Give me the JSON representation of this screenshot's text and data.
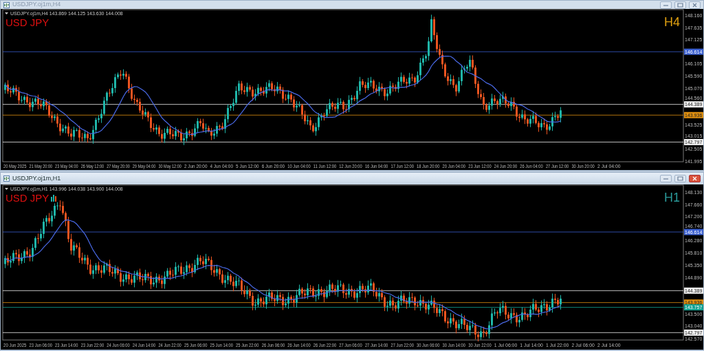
{
  "windows": [
    {
      "title": "USDJPY.oj1m,H4",
      "active": false,
      "header": "USDJPY.oj1m,H4  143.869 144.125 143.630 144.008",
      "symbol": "USD JPY",
      "timeframe": {
        "text": "H4",
        "color": "#e0a010"
      },
      "price_axis": [
        "148.160",
        "147.635",
        "147.125",
        "146.105",
        "145.590",
        "145.070",
        "144.560",
        "143.525",
        "143.015",
        "142.505",
        "141.995"
      ],
      "price_tags": [
        {
          "text": "146.614",
          "color": "#3a5fd0"
        },
        {
          "text": "144.389",
          "color": "#f0f0f0"
        },
        {
          "text": "143.936",
          "color": "#e09010"
        },
        {
          "text": "142.797",
          "color": "#f0f0f0"
        }
      ],
      "time_axis": [
        "20 May 2025",
        "21 May 20:00",
        "23 May 04:00",
        "26 May 12:00",
        "27 May 20:00",
        "29 May 04:00",
        "30 May 12:00",
        "2 Jun 20:00",
        "4 Jun 04:00",
        "5 Jun 12:00",
        "6 Jun 20:00",
        "10 Jun 04:00",
        "11 Jun 12:00",
        "12 Jun 20:00",
        "16 Jun 04:00",
        "17 Jun 12:00",
        "18 Jun 20:00",
        "20 Jun 04:00",
        "23 Jun 12:00",
        "24 Jun 20:00",
        "26 Jun 04:00",
        "27 Jun 12:00",
        "30 Jun 20:00",
        "2 Jul 04:00"
      ]
    },
    {
      "title": "USDJPY.oj1m,H1",
      "active": true,
      "header": "USDJPY.oj1m,H1  143.996 144.038 143.900 144.008",
      "symbol": "USD JPY",
      "timeframe": {
        "text": "H1",
        "color": "#2a9a9a"
      },
      "price_axis": [
        "148.130",
        "147.660",
        "147.200",
        "146.740",
        "146.280",
        "145.810",
        "145.350",
        "144.890",
        "143.500",
        "143.040",
        "142.570"
      ],
      "price_tags": [
        {
          "text": "146.614",
          "color": "#3a5fd0"
        },
        {
          "text": "144.389",
          "color": "#f0f0f0"
        },
        {
          "text": "143.936",
          "color": "#e09010"
        },
        {
          "text": "143.757",
          "color": "#10a090"
        },
        {
          "text": "142.797",
          "color": "#f0f0f0"
        }
      ],
      "time_axis": [
        "20 Jun 2025",
        "23 Jun 06:00",
        "23 Jun 14:00",
        "23 Jun 22:00",
        "24 Jun 06:00",
        "24 Jun 14:00",
        "24 Jun 22:00",
        "25 Jun 06:00",
        "25 Jun 14:00",
        "25 Jun 22:00",
        "26 Jun 06:00",
        "26 Jun 14:00",
        "26 Jun 22:00",
        "27 Jun 06:00",
        "27 Jun 14:00",
        "27 Jun 22:00",
        "30 Jun 06:00",
        "30 Jun 14:00",
        "30 Jun 22:00",
        "1 Jul 06:00",
        "1 Jul 14:00",
        "1 Jul 22:00",
        "2 Jul 06:00",
        "2 Jul 14:00"
      ]
    }
  ]
}
